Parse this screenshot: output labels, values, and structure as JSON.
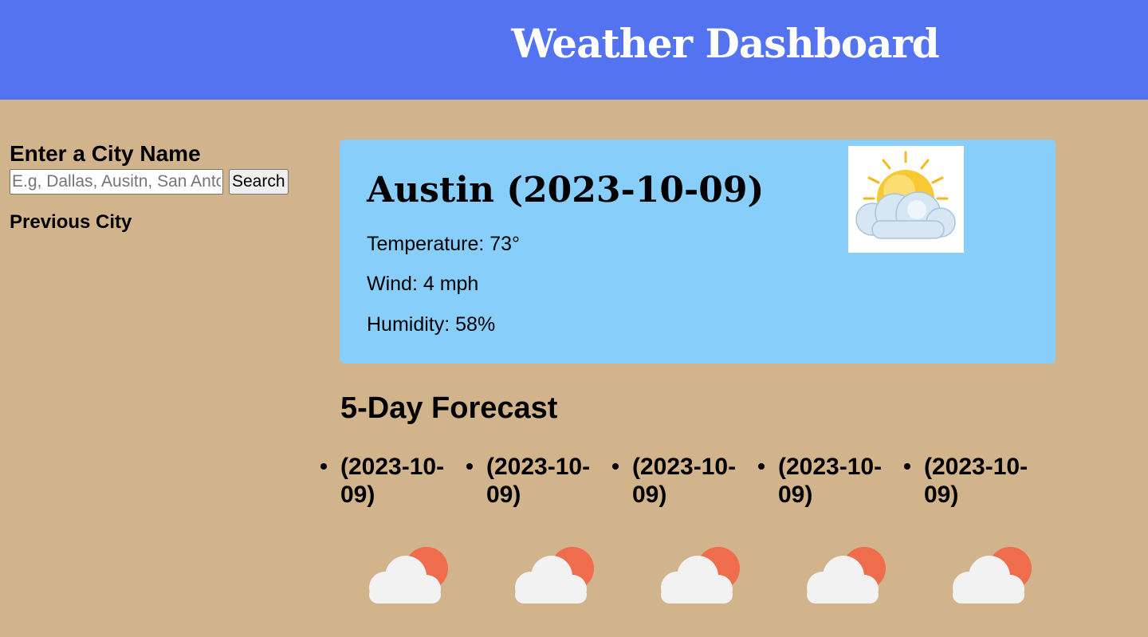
{
  "header": {
    "title": "Weather Dashboard",
    "background": "#5473f1"
  },
  "search": {
    "heading": "Enter a City Name",
    "placeholder": "E.g, Dallas, Ausitn, San Antonio",
    "button_label": "Search",
    "previous_heading": "Previous City"
  },
  "current": {
    "title": "Austin (2023-10-09)",
    "temperature": "Temperature: 73°",
    "wind": "Wind: 4 mph",
    "humidity": "Humidity: 58%",
    "icon": "partly-cloudy-icon",
    "card_color": "#87cefa"
  },
  "forecast": {
    "title": "5-Day Forecast",
    "days": [
      {
        "date": "(2023-10-09)",
        "icon": "cloud-sun-icon"
      },
      {
        "date": "(2023-10-09)",
        "icon": "cloud-sun-icon"
      },
      {
        "date": "(2023-10-09)",
        "icon": "cloud-sun-icon"
      },
      {
        "date": "(2023-10-09)",
        "icon": "cloud-sun-icon"
      },
      {
        "date": "(2023-10-09)",
        "icon": "cloud-sun-icon"
      }
    ]
  },
  "colors": {
    "page_background": "#d2b48c",
    "sun": "#ef6c4d",
    "cloud": "#f2f2f2"
  }
}
